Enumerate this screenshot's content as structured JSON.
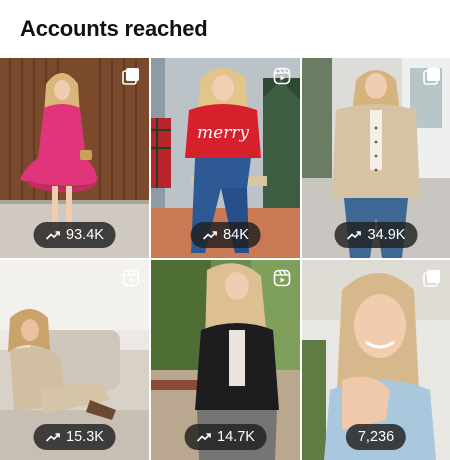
{
  "header": {
    "title": "Accounts reached"
  },
  "posts": [
    {
      "reach": "93.4K",
      "show_trend_icon": true,
      "media_type": "carousel-icon"
    },
    {
      "reach": "84K",
      "show_trend_icon": true,
      "media_type": "reel-icon"
    },
    {
      "reach": "34.9K",
      "show_trend_icon": true,
      "media_type": "carousel-icon"
    },
    {
      "reach": "15.3K",
      "show_trend_icon": true,
      "media_type": "reel-icon"
    },
    {
      "reach": "14.7K",
      "show_trend_icon": true,
      "media_type": "reel-icon"
    },
    {
      "reach": "7,236",
      "show_trend_icon": false,
      "media_type": "carousel-icon"
    }
  ],
  "photo_text": {
    "sweater_word": "merry"
  },
  "colors": {
    "pill_bg": "#202020",
    "pill_text": "#ffffff",
    "sweater_red": "#d8202c",
    "dress_pink": "#e0357a"
  }
}
